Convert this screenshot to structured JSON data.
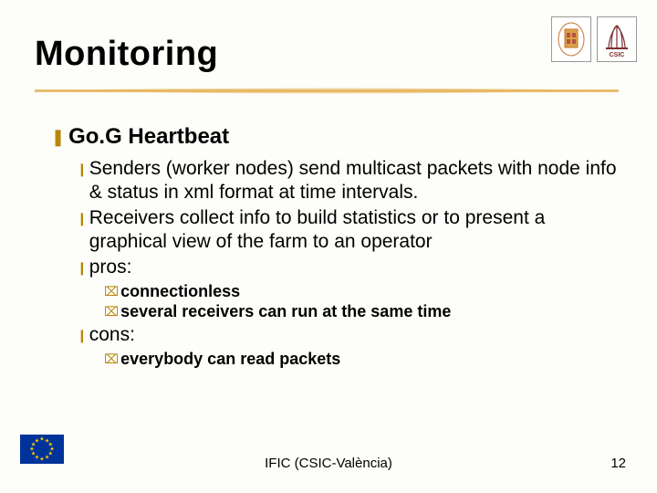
{
  "title": "Monitoring",
  "logos": {
    "left_alt": "university-crest",
    "right_alt": "csic-logo"
  },
  "lvl1": {
    "bullet": "❚",
    "text": "Go.G Heartbeat"
  },
  "lvl2": [
    {
      "bullet": "❙",
      "text": "Senders (worker nodes) send multicast packets with node info & status in xml format at time intervals."
    },
    {
      "bullet": "❙",
      "text": "Receivers collect info to build statistics or to present a graphical view of the farm to an operator"
    },
    {
      "bullet": "❙",
      "text": "pros:"
    }
  ],
  "lvl3a": [
    {
      "bullet": "⌧",
      "text": "connectionless"
    },
    {
      "bullet": "⌧",
      "text": "several receivers can run at the same time"
    }
  ],
  "lvl2b": [
    {
      "bullet": "❙",
      "text": "cons:"
    }
  ],
  "lvl3b": [
    {
      "bullet": "⌧",
      "text": "everybody can read packets"
    }
  ],
  "footer": {
    "center": "IFIC (CSIC-València)",
    "page": "12"
  }
}
